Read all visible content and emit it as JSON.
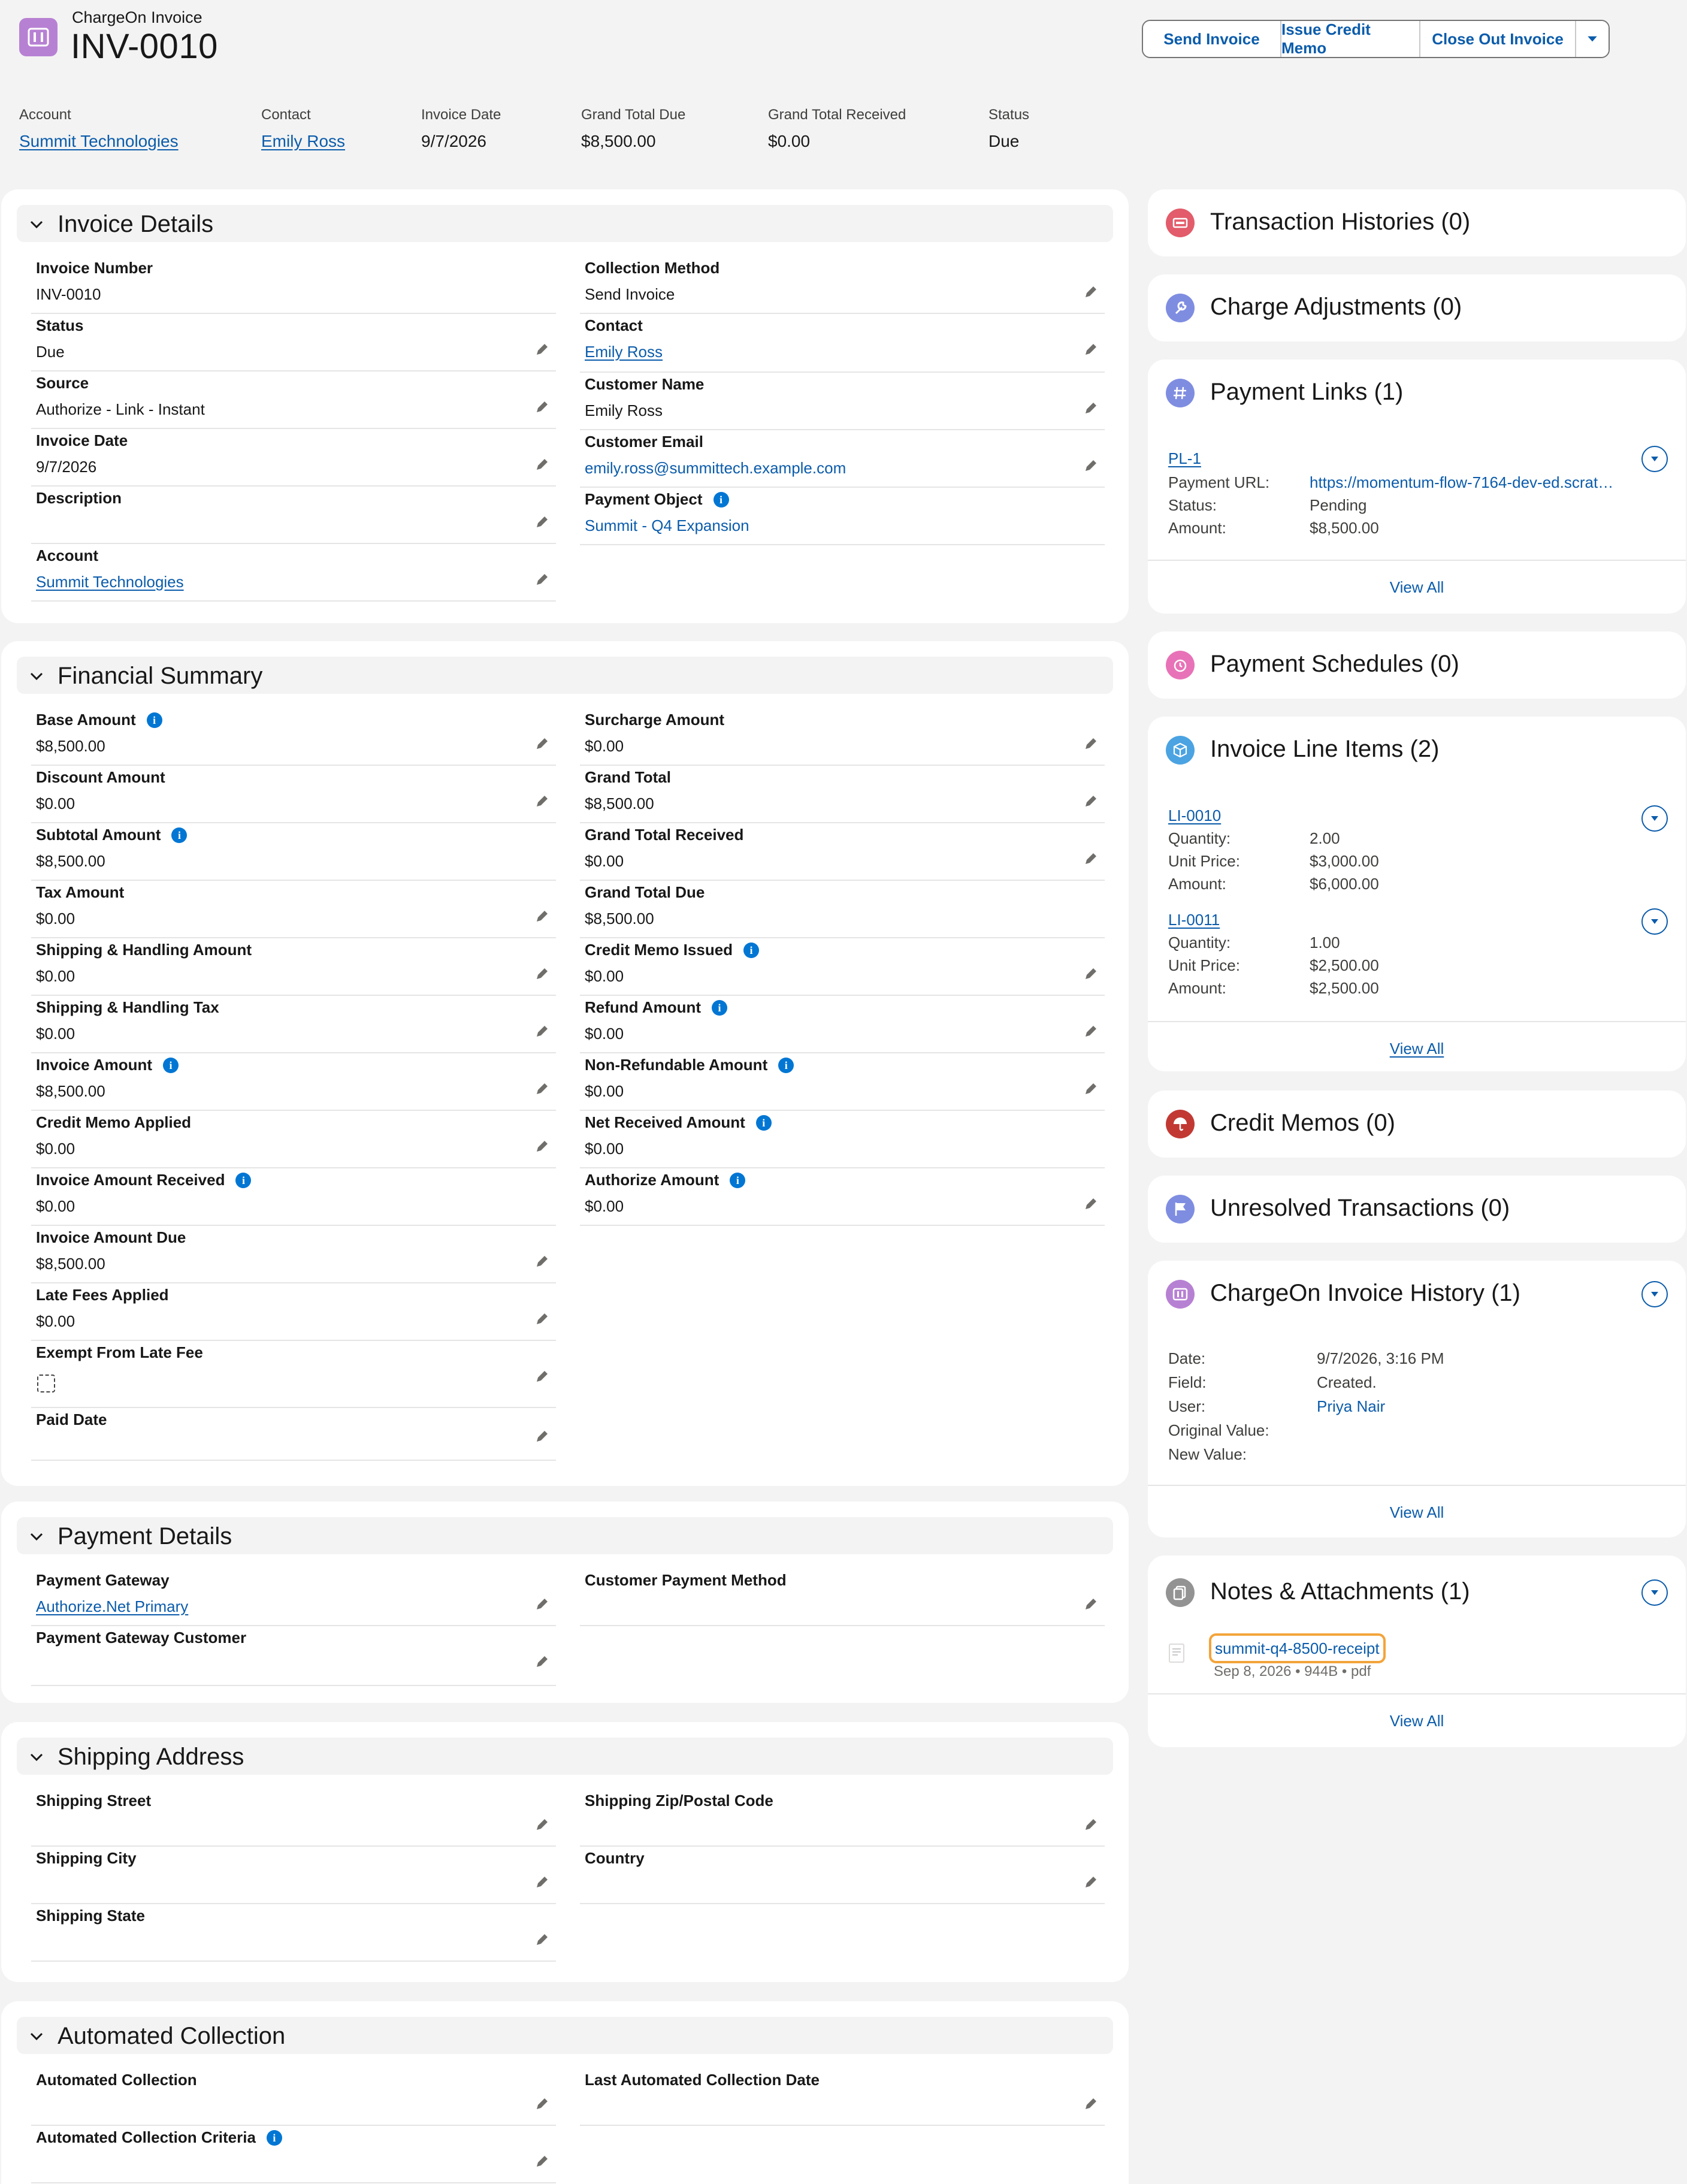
{
  "header": {
    "object_type": "ChargeOn Invoice",
    "title": "INV-0010",
    "buttons": {
      "send": "Send Invoice",
      "credit": "Issue Credit Memo",
      "close": "Close Out Invoice"
    },
    "highlights": [
      {
        "label": "Account",
        "value": "Summit Technologies"
      },
      {
        "label": "Contact",
        "value": "Emily Ross"
      },
      {
        "label": "Invoice Date",
        "value": "9/7/2026"
      },
      {
        "label": "Grand Total Due",
        "value": "$8,500.00"
      },
      {
        "label": "Grand Total Received",
        "value": "$0.00"
      },
      {
        "label": "Status",
        "value": "Due"
      }
    ]
  },
  "invoice_details": {
    "title": "Invoice Details",
    "invoice_number": {
      "label": "Invoice Number",
      "value": "INV-0010"
    },
    "status": {
      "label": "Status",
      "value": "Due"
    },
    "source": {
      "label": "Source",
      "value": "Authorize - Link - Instant"
    },
    "invoice_date": {
      "label": "Invoice Date",
      "value": "9/7/2026"
    },
    "description": {
      "label": "Description",
      "value": ""
    },
    "account": {
      "label": "Account",
      "value": "Summit Technologies"
    },
    "collection_method": {
      "label": "Collection Method",
      "value": "Send Invoice"
    },
    "contact": {
      "label": "Contact",
      "value": "Emily Ross"
    },
    "customer_name": {
      "label": "Customer Name",
      "value": "Emily Ross"
    },
    "customer_email": {
      "label": "Customer Email",
      "value": "emily.ross@summittech.example.com"
    },
    "payment_object": {
      "label": "Payment Object",
      "value": "Summit - Q4 Expansion"
    }
  },
  "financial_summary": {
    "title": "Financial Summary",
    "base_amount": {
      "label": "Base Amount",
      "value": "$8,500.00"
    },
    "discount_amount": {
      "label": "Discount Amount",
      "value": "$0.00"
    },
    "subtotal_amount": {
      "label": "Subtotal Amount",
      "value": "$8,500.00"
    },
    "tax_amount": {
      "label": "Tax Amount",
      "value": "$0.00"
    },
    "shipping_handling_amount": {
      "label": "Shipping & Handling Amount",
      "value": "$0.00"
    },
    "shipping_handling_tax": {
      "label": "Shipping & Handling Tax",
      "value": "$0.00"
    },
    "invoice_amount": {
      "label": "Invoice Amount",
      "value": "$8,500.00"
    },
    "credit_memo_applied": {
      "label": "Credit Memo Applied",
      "value": "$0.00"
    },
    "invoice_amount_received": {
      "label": "Invoice Amount Received",
      "value": "$0.00"
    },
    "invoice_amount_due": {
      "label": "Invoice Amount Due",
      "value": "$8,500.00"
    },
    "late_fees_applied": {
      "label": "Late Fees Applied",
      "value": "$0.00"
    },
    "exempt_from_late_fee": {
      "label": "Exempt From Late Fee",
      "checked": false
    },
    "paid_date": {
      "label": "Paid Date",
      "value": ""
    },
    "surcharge_amount": {
      "label": "Surcharge Amount",
      "value": "$0.00"
    },
    "grand_total": {
      "label": "Grand Total",
      "value": "$8,500.00"
    },
    "grand_total_received": {
      "label": "Grand Total Received",
      "value": "$0.00"
    },
    "grand_total_due": {
      "label": "Grand Total Due",
      "value": "$8,500.00"
    },
    "credit_memo_issued": {
      "label": "Credit Memo Issued",
      "value": "$0.00"
    },
    "refund_amount": {
      "label": "Refund Amount",
      "value": "$0.00"
    },
    "non_refundable_amount": {
      "label": "Non-Refundable Amount",
      "value": "$0.00"
    },
    "net_received_amount": {
      "label": "Net Received Amount",
      "value": "$0.00"
    },
    "authorize_amount": {
      "label": "Authorize Amount",
      "value": "$0.00"
    }
  },
  "payment_details": {
    "title": "Payment Details",
    "payment_gateway": {
      "label": "Payment Gateway",
      "value": "Authorize.Net Primary"
    },
    "payment_gateway_customer": {
      "label": "Payment Gateway Customer",
      "value": ""
    },
    "customer_payment_method": {
      "label": "Customer Payment Method",
      "value": ""
    }
  },
  "shipping_address": {
    "title": "Shipping Address",
    "street": {
      "label": "Shipping Street",
      "value": ""
    },
    "city": {
      "label": "Shipping City",
      "value": ""
    },
    "state": {
      "label": "Shipping State",
      "value": ""
    },
    "zip": {
      "label": "Shipping Zip/Postal Code",
      "value": ""
    },
    "country": {
      "label": "Country",
      "value": ""
    }
  },
  "automated_collection": {
    "title": "Automated Collection",
    "automated_collection": {
      "label": "Automated Collection",
      "value": ""
    },
    "criteria": {
      "label": "Automated Collection Criteria",
      "value": ""
    },
    "last_date": {
      "label": "Last Automated Collection Date",
      "value": ""
    }
  },
  "related": {
    "transaction_histories": {
      "title": "Transaction Histories (0)",
      "color": "#e25c6b"
    },
    "charge_adjustments": {
      "title": "Charge Adjustments (0)",
      "color": "#7f8de1"
    },
    "payment_links": {
      "title": "Payment Links (1)",
      "color": "#7f8de1",
      "record": "PL-1",
      "url_label": "Payment URL:",
      "url": "https://momentum-flow-7164-dev-ed.scrat…",
      "status_label": "Status:",
      "status": "Pending",
      "amount_label": "Amount:",
      "amount": "$8,500.00",
      "view_all": "View All"
    },
    "payment_schedules": {
      "title": "Payment Schedules (0)",
      "color": "#e872b7"
    },
    "invoice_line_items": {
      "title": "Invoice Line Items (2)",
      "color": "#4ba3e2",
      "items": [
        {
          "name": "LI-0010",
          "quantity_label": "Quantity:",
          "quantity": "2.00",
          "unit_price_label": "Unit Price:",
          "unit_price": "$3,000.00",
          "amount_label": "Amount:",
          "amount": "$6,000.00"
        },
        {
          "name": "LI-0011",
          "quantity_label": "Quantity:",
          "quantity": "1.00",
          "unit_price_label": "Unit Price:",
          "unit_price": "$2,500.00",
          "amount_label": "Amount:",
          "amount": "$2,500.00"
        }
      ],
      "view_all": "View All"
    },
    "credit_memos": {
      "title": "Credit Memos (0)",
      "color": "#c23934"
    },
    "unresolved_transactions": {
      "title": "Unresolved Transactions (0)",
      "color": "#7f8de1"
    },
    "invoice_history": {
      "title": "ChargeOn Invoice History (1)",
      "color": "#b781d3",
      "date_label": "Date:",
      "date": "9/7/2026, 3:16 PM",
      "field_label": "Field:",
      "field": "Created.",
      "user_label": "User:",
      "user": "Priya Nair",
      "original_label": "Original Value:",
      "new_label": "New Value:",
      "view_all": "View All"
    },
    "notes_attachments": {
      "title": "Notes & Attachments (1)",
      "color": "#939393",
      "file_name": "summit-q4-8500-receipt",
      "file_meta": "Sep 8, 2026 • 944B • pdf",
      "view_all": "View All"
    }
  }
}
